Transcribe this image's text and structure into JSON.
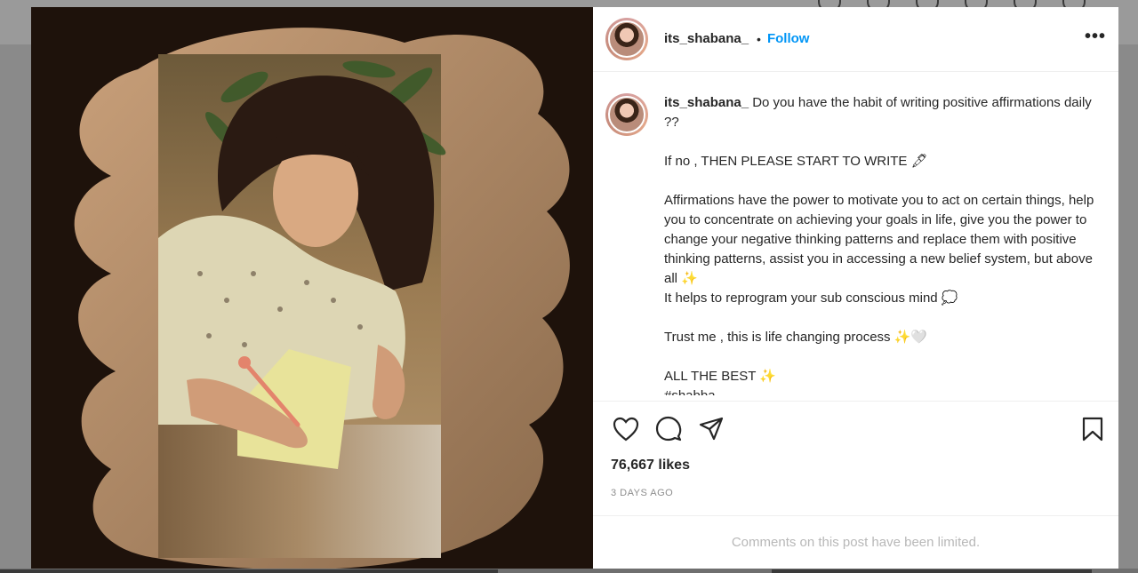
{
  "post": {
    "username": "its_shabana_",
    "follow_label": "Follow",
    "separator": "•",
    "more_label": "•••"
  },
  "caption": {
    "username": "its_shabana_",
    "text": " Do you have the habit of writing positive affirmations daily ??\n\nIf no , THEN PLEASE START TO WRITE 🖋\n\nAffirmations have the power to motivate you to act on certain things, help you to concentrate on achieving your goals in life, give you the power to change your negative thinking patterns and replace them with positive thinking patterns, assist you in accessing a new belief system, but above all ✨\nIt helps to reprogram your sub conscious mind 💭\n\nTrust me , this is life changing process ✨🤍\n\nALL THE BEST ✨\n#shabba"
  },
  "actions": {
    "like_icon": "heart-icon",
    "comment_icon": "comment-icon",
    "share_icon": "paper-plane-icon",
    "save_icon": "bookmark-icon"
  },
  "likes": "76,667 likes",
  "timestamp": "3 DAYS AGO",
  "comments_notice": "Comments on this post have been limited.",
  "colors": {
    "accent": "#0095f6",
    "text": "#262626",
    "muted": "#8e8e8e",
    "photo_frame": "#b08d6e"
  }
}
